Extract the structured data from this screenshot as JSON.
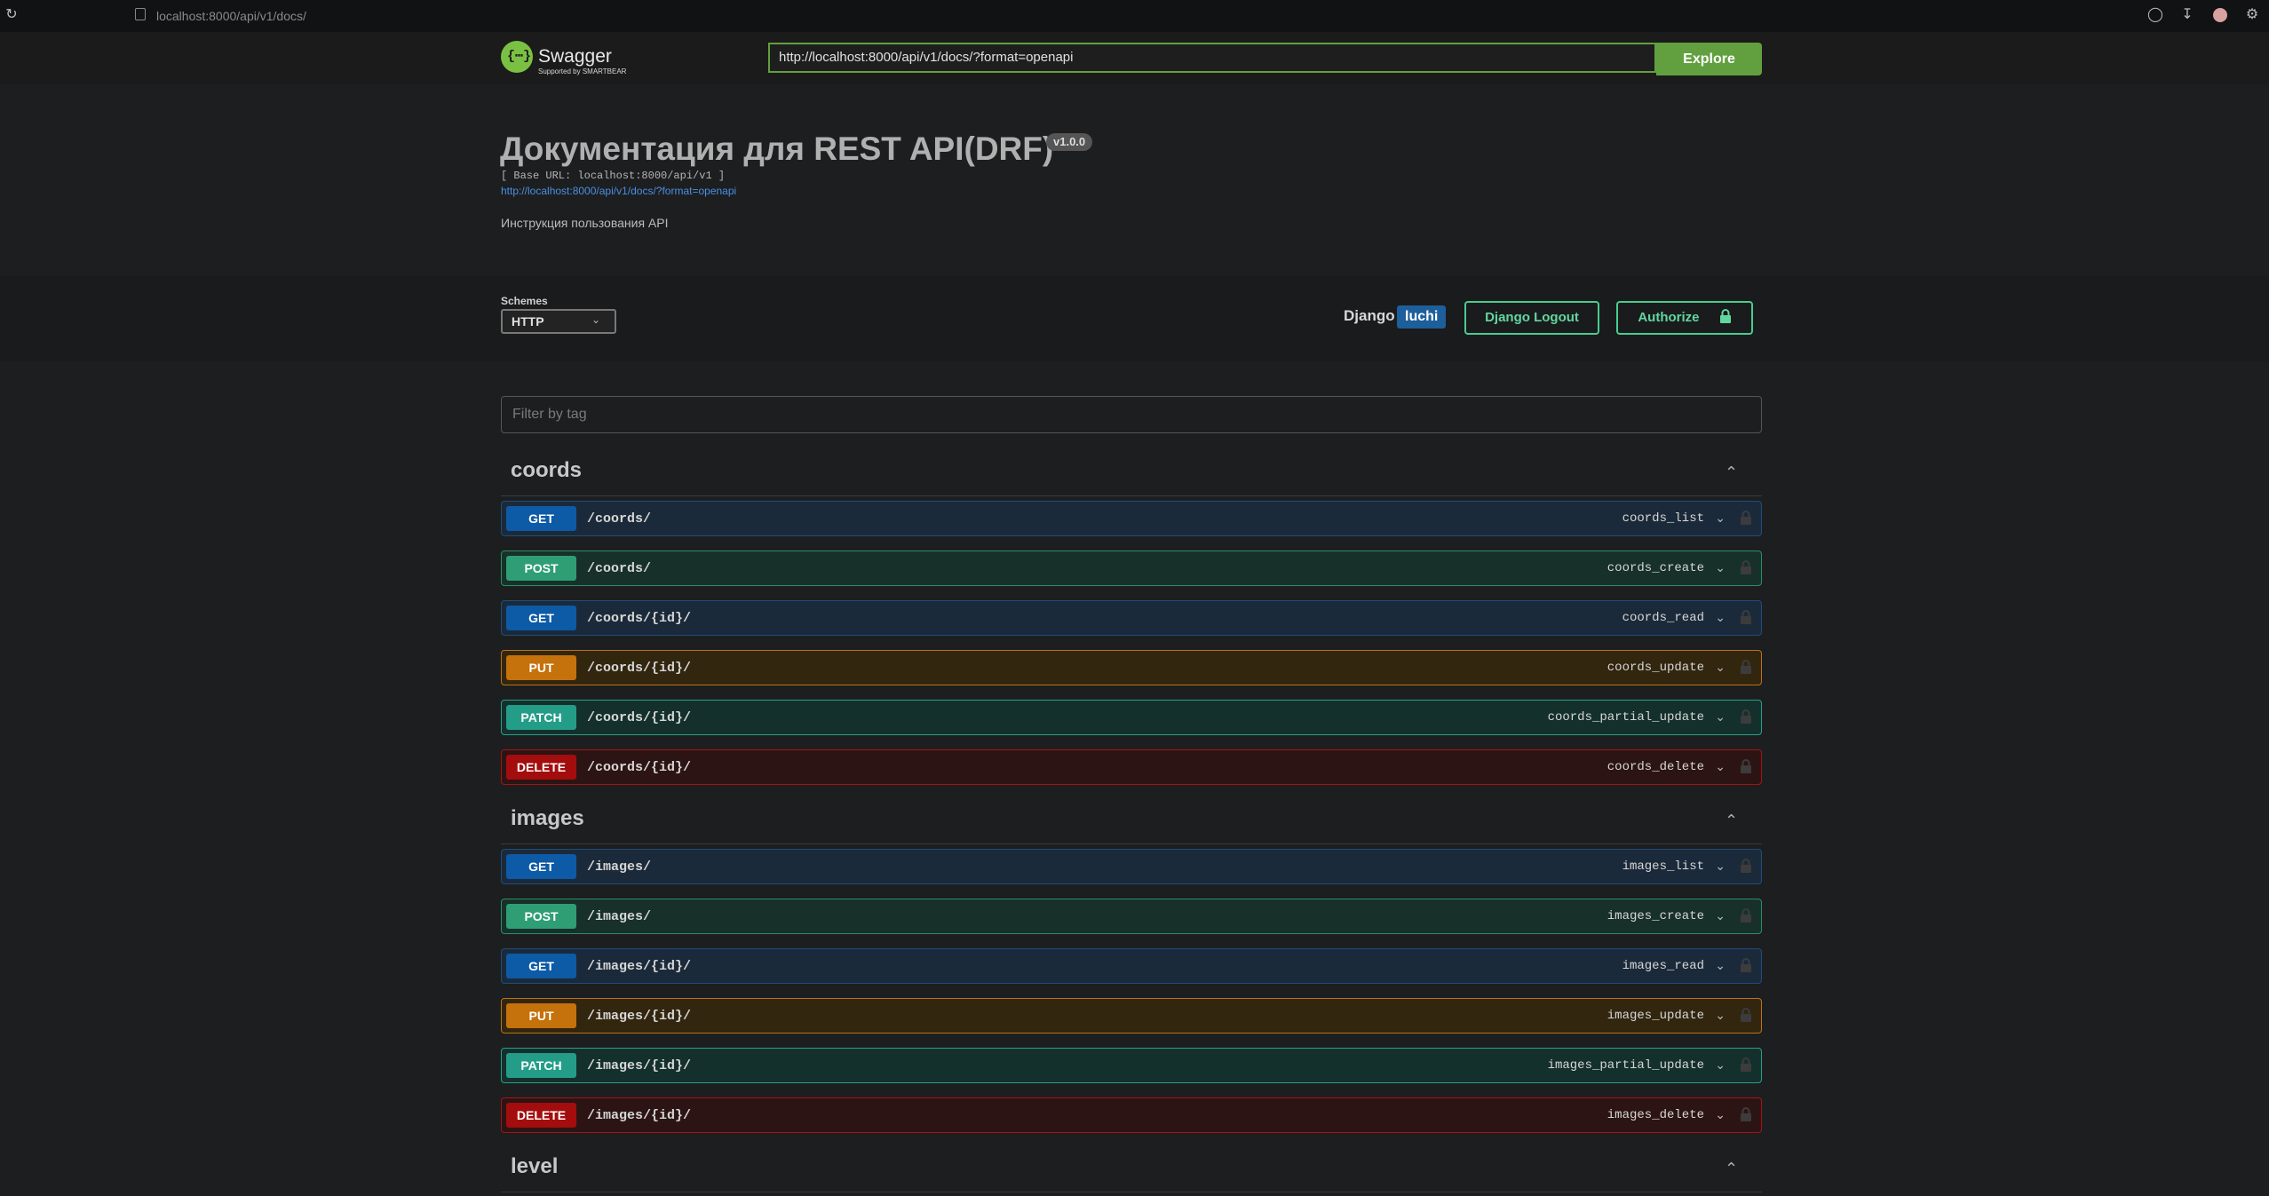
{
  "browser": {
    "url": "localhost:8000/api/v1/docs/"
  },
  "topbar": {
    "logo_text": "Swagger",
    "logo_sub": "Supported by SMARTBEAR",
    "spec_url_value": "http://localhost:8000/api/v1/docs/?format=openapi",
    "explore_label": "Explore"
  },
  "info": {
    "title": "Документация для REST API(DRF)",
    "version": "v1.0.0",
    "base_url": "[ Base URL: localhost:8000/api/v1 ]",
    "spec_link": "http://localhost:8000/api/v1/docs/?format=openapi",
    "description": "Инструкция пользования API"
  },
  "schemes": {
    "label": "Schemes",
    "selected": "HTTP"
  },
  "auth": {
    "django_label": "Django",
    "username": "luchi",
    "logout_label": "Django Logout",
    "authorize_label": "Authorize"
  },
  "filter": {
    "placeholder": "Filter by tag"
  },
  "tags": [
    {
      "name": "coords",
      "ops": [
        {
          "method": "GET",
          "path": "/coords/",
          "id": "coords_list"
        },
        {
          "method": "POST",
          "path": "/coords/",
          "id": "coords_create"
        },
        {
          "method": "GET",
          "path": "/coords/{id}/",
          "id": "coords_read"
        },
        {
          "method": "PUT",
          "path": "/coords/{id}/",
          "id": "coords_update"
        },
        {
          "method": "PATCH",
          "path": "/coords/{id}/",
          "id": "coords_partial_update"
        },
        {
          "method": "DELETE",
          "path": "/coords/{id}/",
          "id": "coords_delete"
        }
      ]
    },
    {
      "name": "images",
      "ops": [
        {
          "method": "GET",
          "path": "/images/",
          "id": "images_list"
        },
        {
          "method": "POST",
          "path": "/images/",
          "id": "images_create"
        },
        {
          "method": "GET",
          "path": "/images/{id}/",
          "id": "images_read"
        },
        {
          "method": "PUT",
          "path": "/images/{id}/",
          "id": "images_update"
        },
        {
          "method": "PATCH",
          "path": "/images/{id}/",
          "id": "images_partial_update"
        },
        {
          "method": "DELETE",
          "path": "/images/{id}/",
          "id": "images_delete"
        }
      ]
    },
    {
      "name": "level",
      "ops": []
    }
  ]
}
